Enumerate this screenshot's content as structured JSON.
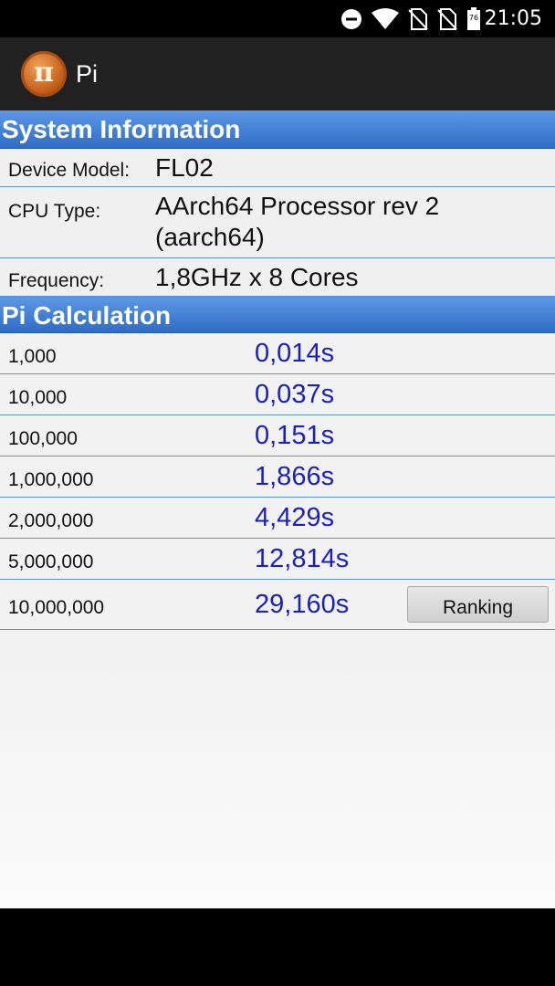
{
  "status_bar": {
    "time": "21:05",
    "battery_level": "76",
    "icons": [
      "do-not-disturb-icon",
      "wifi-icon",
      "no-sim-icon",
      "no-sim-icon",
      "battery-icon"
    ]
  },
  "app_bar": {
    "title": "Pi",
    "logo_glyph": "π"
  },
  "system_info": {
    "header": "System Information",
    "rows": [
      {
        "label": "Device Model:",
        "value": "FL02"
      },
      {
        "label": "CPU Type:",
        "value": "AArch64 Processor rev 2 (aarch64)"
      },
      {
        "label": "Frequency:",
        "value": "1,8GHz x 8 Cores"
      }
    ]
  },
  "pi_calc": {
    "header": "Pi Calculation",
    "rows": [
      {
        "digits": "1,000",
        "time": "0,014s"
      },
      {
        "digits": "10,000",
        "time": "0,037s"
      },
      {
        "digits": "100,000",
        "time": "0,151s"
      },
      {
        "digits": "1,000,000",
        "time": "1,866s"
      },
      {
        "digits": "2,000,000",
        "time": "4,429s"
      },
      {
        "digits": "5,000,000",
        "time": "12,814s"
      },
      {
        "digits": "10,000,000",
        "time": "29,160s"
      }
    ],
    "ranking_label": "Ranking"
  },
  "colors": {
    "header_blue": "#2f6cc5",
    "time_blue": "#1a1fc0",
    "app_bar": "#212121"
  }
}
